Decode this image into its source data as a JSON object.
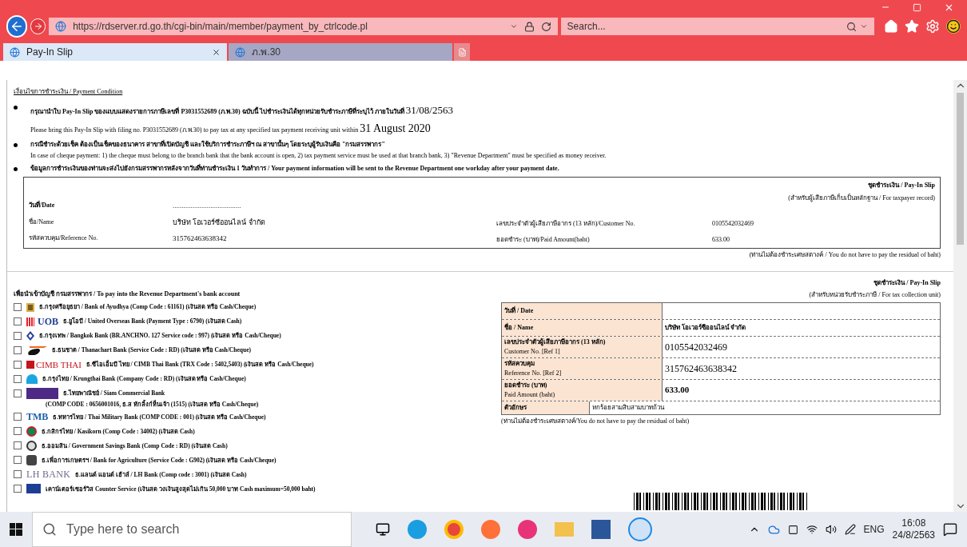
{
  "browser": {
    "url": "https://rdserver.rd.go.th/cgi-bin/main/member/payment_by_ctrlcode.pl",
    "search_placeholder": "Search...",
    "tabs": [
      {
        "label": "Pay-In Slip",
        "selected": true
      },
      {
        "label": "ภ.พ.30",
        "selected": false
      }
    ]
  },
  "conditions": {
    "heading": "เงื่อนไขการชำระเงิน / Payment Condition",
    "items": [
      {
        "thai": "กรุณานำใบ Pay-In Slip ของแบบแสดงรายการภาษีเลขที่ P3031552689 (ภ.พ.30) ฉบับนี้ ไปชำระเงินได้ทุกหน่วยรับชำระภาษีที่ระบุไว้ ภายในวันที่",
        "thai_date": "31/08/2563",
        "english": "Please bring this Pay-In Slip with filing no. P3031552689 (ภ.พ.30) to pay tax at any specified tax payment receiving unit within",
        "english_date": "31 August 2020"
      },
      {
        "thai": "กรณีชำระด้วยเช็ค ต้องเป็นเช็คของธนาคาร สาขาที่เปิดบัญชี และใช้บริการชำระภาษีฯ ณ สาขานั้นๆ โดยระบุผู้รับเงินคือ \"กรมสรรพากร\"",
        "english": "In case of cheque payment: 1) the cheque must belong to the branch bank that the bank account is open, 2) tax payment service must be used at that branch bank, 3) \"Revenue Department\" must be specified as money receiver."
      },
      {
        "thai": "ข้อมูลการชำระเงินของท่านจะส่งไปยังกรมสรรพากรหลังจากวันที่ท่านชำระเงิน 1 วันทำการ / Your payment information will be sent to the Revenue Department one workday after your payment date."
      }
    ]
  },
  "taxpayer_slip": {
    "title": "ชุดชำระเงิน / Pay-In Slip",
    "subtitle": "(สำหรับผู้เสียภาษีเก็บเป็นหลักฐาน / For taxpayer record)",
    "left_rows": [
      {
        "label": "วันที่/Date",
        "value": "......................................"
      },
      {
        "label": "ชื่อ/Name",
        "value": "บริษัท โอเวอร์ซีออนไลน์ จำกัด"
      },
      {
        "label": "รหัสควบคุม/Reference No.",
        "value": "315762463638342"
      }
    ],
    "right_rows": [
      {
        "label": "เลขประจำตัวผู้เสียภาษีอากร (13 หลัก)/Customer No.",
        "value": "0105542032469"
      },
      {
        "label": "ยอดชำระ (บาท)/Paid Amount(baht)",
        "value": "633.00"
      }
    ],
    "note": "(ท่านไม่ต้องชำระเศษสตางค์ / You do not have to pay the residual of baht)"
  },
  "bank_section": {
    "heading": "เพื่อนำเข้าบัญชี กรมสรรพากร / To pay into the Revenue Department's bank account",
    "banks": [
      {
        "kind": "ayudhya",
        "text": "ธ.กรุงศรีอยุธยา / Bank of Ayudhya (Comp Code : 61161) (เงินสด หรือ Cash/Cheque)",
        "checked": false
      },
      {
        "kind": "uob",
        "logo_text": "UOB",
        "text": "ธ.ยูโอบี / United Overseas Bank (Payment Type : 6790) (เงินสด Cash)",
        "checked": false
      },
      {
        "kind": "bangkok",
        "text": "ธ.กรุงเทพ / Bangkok Bank (BR.ANCHNO. 127 Service code : 997) (เงินสด หรือ Cash/Cheque)",
        "checked": false
      },
      {
        "kind": "thanachart",
        "text": "ธ.ธนชาต / Thanachart Bank (Service Code : RD) (เงินสด หรือ Cash/Cheque)",
        "checked": false
      },
      {
        "kind": "cimb",
        "logo_text": "CIMB THAI",
        "text": "ธ.ซีไอเอ็มบี ไทย / CIMB Thai Bank (TRX Code : 5402,5403) (เงินสด หรือ Cash/Cheque)",
        "checked": false
      },
      {
        "kind": "krungthai",
        "text": "ธ.กรุงไทย / Krungthai Bank (Company Code : RD) (เงินสด หรือ Cash/Cheque)",
        "checked": false
      },
      {
        "kind": "scb",
        "text": "ธ.ไทยพาณิชย์ / Siam Commercial Bank",
        "sub": "(COMP CODE : 0656001016, ธ.ส หักลิ้งก์ห็นเจ้า (1515) (เงินสด หรือ Cash/Cheque)",
        "checked": false
      },
      {
        "kind": "tmb",
        "logo_text": "TMB",
        "text": "ธ.ทหารไทย / Thai Military Bank (COMP CODE : 001) (เงินสด หรือ Cash/Cheque)",
        "checked": false
      },
      {
        "kind": "kasikorn",
        "text": "ธ.กสิกรไทย / Kasikorn (Comp Code : 34002) (เงินสด Cash)",
        "checked": false
      },
      {
        "kind": "gsb",
        "text": "ธ.ออมสิน / Government Savings Bank (Comp Code : RD) (เงินสด Cash)",
        "checked": false
      },
      {
        "kind": "baac",
        "text": "ธ.เพื่อการเกษตรฯ / Bank for Agriculture (Service Code : G902) (เงินสด หรือ Cash/Cheque)",
        "checked": false
      },
      {
        "kind": "lh",
        "logo_text": "LH BANK",
        "text": "ธ.แลนด์ แอนด์ เฮ้าส์ / LH Bank (Comp code : 3001) (เงินสด Cash)",
        "checked": false
      },
      {
        "kind": "counter",
        "text": "เคาน์เตอร์เซอร์วิส Counter Service (เงินสด วงเงินสูงสุดไม่เกิน 50,000 บาท Cash maximum=50,000 baht)",
        "checked": false
      }
    ]
  },
  "unit_slip": {
    "title": "ชุดชำระเงิน / Pay-In Slip",
    "subtitle": "(สำหรับหน่วยรับชำระภาษี / For tax collection unit)",
    "rows": [
      {
        "kind": "plain",
        "label_thai": "วันที่ / Date"
      },
      {
        "kind": "plain",
        "label_thai": "ชื่อ / Name",
        "value": "บริษัท โอเวอร์ซีออนไลน์ จำกัด"
      },
      {
        "kind": "large",
        "label_thai": "เลขประจำตัวผู้เสียภาษีอากร (13 หลัก)",
        "label_en": "Customer No. [Ref 1]",
        "value": "0105542032469"
      },
      {
        "kind": "large",
        "label_thai": "รหัสควบคุม",
        "label_en": "Reference No. [Ref 2]",
        "value": "315762463638342"
      },
      {
        "kind": "bold",
        "label_thai": "ยอดชำระ (บาท)",
        "label_en": "Paid Amount (baht)",
        "value": "633.00"
      }
    ],
    "words_label": "ตัวอักษร",
    "words_value": "หกร้อยสามสิบสามบาทถ้วน",
    "note": "(ท่านไม่ต้องชำระเศษสตางค์/You do not have to pay the residual of baht)"
  },
  "taskbar": {
    "search_placeholder": "Type here to search",
    "language": "ENG",
    "time": "16:08",
    "date": "24/8/2563"
  }
}
